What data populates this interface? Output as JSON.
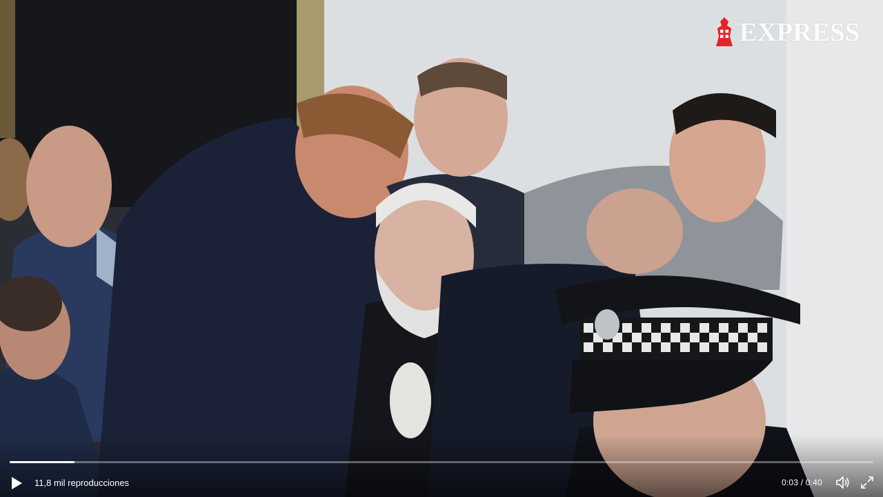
{
  "video": {
    "scene": "video-frame",
    "progress_fraction": 0.075
  },
  "watermark": {
    "text": "EXPRESS",
    "icon": "crusader-knight-logo-icon",
    "color": "#e0262b"
  },
  "controls": {
    "views_text": "11,8 mil reproducciones",
    "time_text": "0:03 / 0:40",
    "play_icon": "play-icon",
    "volume_icon": "volume-icon",
    "fullscreen_icon": "fullscreen-icon"
  }
}
